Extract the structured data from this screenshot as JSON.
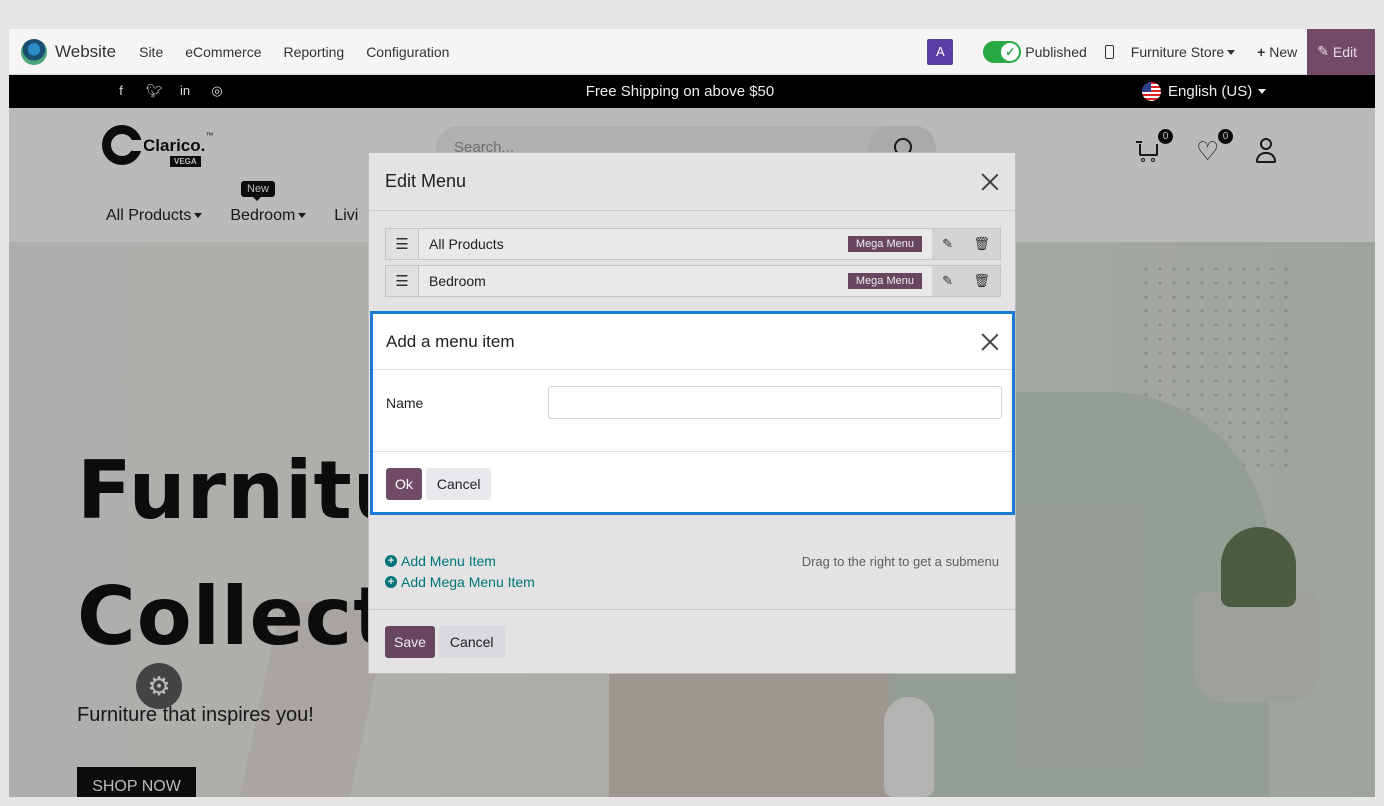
{
  "topbar": {
    "app_name": "Website",
    "menu": [
      "Site",
      "eCommerce",
      "Reporting",
      "Configuration"
    ],
    "avatar_letter": "A",
    "published_label": "Published",
    "store_selector": "Furniture Store",
    "new_label": "New",
    "edit_label": "Edit"
  },
  "announcement": {
    "text": "Free Shipping on above $50",
    "language": "English (US)",
    "social_icons": [
      "facebook-icon",
      "twitter-icon",
      "linkedin-icon",
      "instagram-icon"
    ]
  },
  "header": {
    "logo_text": "Clarico.",
    "logo_tm": "™",
    "logo_sub": "VEGA",
    "search_placeholder": "Search...",
    "cart_count": "0",
    "wishlist_count": "0",
    "nav": [
      "All Products",
      "Bedroom",
      "Livi"
    ],
    "new_tag": "New"
  },
  "hero": {
    "title_line1": "Furnitu",
    "title_line2": "Collect",
    "subtitle": "Furniture that inspires you!",
    "button": "SHOP NOW"
  },
  "edit_menu": {
    "title": "Edit Menu",
    "items": [
      {
        "name": "All Products",
        "badge": "Mega Menu"
      },
      {
        "name": "Bedroom",
        "badge": "Mega Menu"
      }
    ],
    "add_menu_item": "Add Menu Item",
    "add_mega_menu_item": "Add Mega Menu Item",
    "hint": "Drag to the right to get a submenu",
    "save": "Save",
    "cancel": "Cancel"
  },
  "add_item_dialog": {
    "title": "Add a menu item",
    "name_label": "Name",
    "name_value": "",
    "ok": "Ok",
    "cancel": "Cancel"
  },
  "colors": {
    "brand": "#714b67",
    "link": "#017e84",
    "focus_border": "#1b7bd0",
    "published_toggle": "#28a745"
  }
}
